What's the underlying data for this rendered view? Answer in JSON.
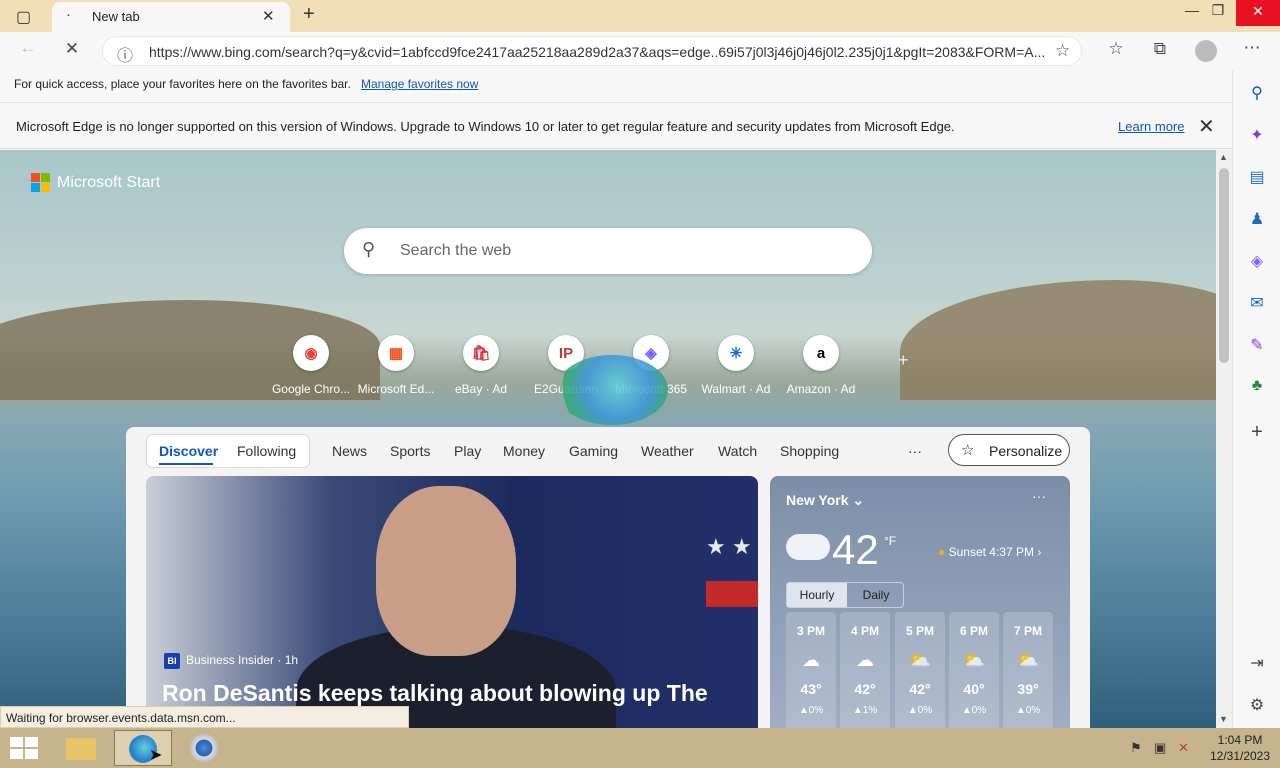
{
  "tab": {
    "title": "New tab"
  },
  "window": {
    "minimize": "—",
    "restore": "❐",
    "close": "✕"
  },
  "address": {
    "url": "https://www.bing.com/search?q=y&cvid=1abfccd9fce2417aa25218aa289d2a37&aqs=edge..69i57j0l3j46j0j46j0l2.235j0j1&pgIt=2083&FORM=A..."
  },
  "favbar": {
    "text": "For quick access, place your favorites here on the favorites bar.",
    "link": "Manage favorites now"
  },
  "infobar": {
    "message": "Microsoft Edge is no longer supported on this version of Windows. Upgrade to Windows 10 or later to get regular feature and security updates from Microsoft Edge.",
    "learn_more": "Learn more"
  },
  "brand": {
    "name": "Microsoft Start"
  },
  "search": {
    "placeholder": "Search the web"
  },
  "quick_links": [
    {
      "label": "Google Chro...",
      "icon": "chrome-icon",
      "glyph": "◉",
      "color": "#db4437"
    },
    {
      "label": "Microsoft Ed...",
      "icon": "microsoft-icon",
      "glyph": "▦",
      "color": "#f25022"
    },
    {
      "label": "eBay · Ad",
      "icon": "ebay-icon",
      "glyph": "🛍",
      "color": "#e53238"
    },
    {
      "label": "E2Guardian",
      "icon": "e2guardian-icon",
      "glyph": "IP",
      "color": "#c0392b"
    },
    {
      "label": "Microsoft 365",
      "icon": "m365-icon",
      "glyph": "◈",
      "color": "#7b61ff"
    },
    {
      "label": "Walmart · Ad",
      "icon": "walmart-icon",
      "glyph": "✳",
      "color": "#0071ce"
    },
    {
      "label": "Amazon · Ad",
      "icon": "amazon-icon",
      "glyph": "a",
      "color": "#000000"
    }
  ],
  "feed": {
    "pivots": [
      "Discover",
      "Following"
    ],
    "nav": [
      "News",
      "Sports",
      "Play",
      "Money",
      "Gaming",
      "Weather",
      "Watch",
      "Shopping"
    ],
    "more": "···",
    "personalize": "Personalize"
  },
  "hero": {
    "source": "Business Insider · 1h",
    "source_badge": "BI",
    "headline": "Ron DeSantis keeps talking about blowing up The"
  },
  "weather": {
    "city": "New York",
    "temp": "42",
    "unit": "°F",
    "sunset": "Sunset 4:37 PM",
    "tabs": [
      "Hourly",
      "Daily"
    ],
    "hours": [
      {
        "time": "3 PM",
        "icon": "☁",
        "temp": "43°",
        "precip": "▲0%"
      },
      {
        "time": "4 PM",
        "icon": "☁",
        "temp": "42°",
        "precip": "▲1%"
      },
      {
        "time": "5 PM",
        "icon": "⛅",
        "temp": "42°",
        "precip": "▲0%"
      },
      {
        "time": "6 PM",
        "icon": "⛅",
        "temp": "40°",
        "precip": "▲0%"
      },
      {
        "time": "7 PM",
        "icon": "⛅",
        "temp": "39°",
        "precip": "▲0%"
      }
    ]
  },
  "status": "Waiting for browser.events.data.msn.com...",
  "clock": {
    "time": "1:04 PM",
    "date": "12/31/2023"
  }
}
